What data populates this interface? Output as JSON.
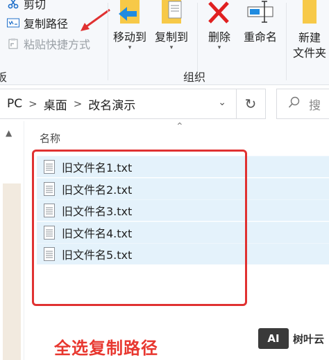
{
  "ribbon": {
    "clipboard": {
      "cut_label": "剪切",
      "copy_path_label": "复制路径",
      "paste_shortcut_label": "粘贴快捷方式",
      "group_label": "板"
    },
    "organize": {
      "move_to_label": "移动到",
      "copy_to_label": "复制到",
      "delete_label": "删除",
      "rename_label": "重命名",
      "group_label": "组织"
    },
    "new": {
      "new_folder_line1": "新建",
      "new_folder_line2": "文件夹"
    }
  },
  "address": {
    "crumbs": [
      "PC",
      "桌面",
      "改名演示"
    ]
  },
  "search": {
    "placeholder": "搜"
  },
  "list": {
    "column_name": "名称",
    "files": [
      {
        "name": "旧文件名1.txt"
      },
      {
        "name": "旧文件名2.txt"
      },
      {
        "name": "旧文件名3.txt"
      },
      {
        "name": "旧文件名4.txt"
      },
      {
        "name": "旧文件名5.txt"
      }
    ]
  },
  "annotation": {
    "caption": "全选复制路径",
    "color": "#e03131"
  },
  "watermark": {
    "logo": "AI",
    "text": "树叶云"
  },
  "colors": {
    "selection": "#e4f2fb",
    "delete_red": "#e02020",
    "folder_yellow": "#f7c948"
  }
}
